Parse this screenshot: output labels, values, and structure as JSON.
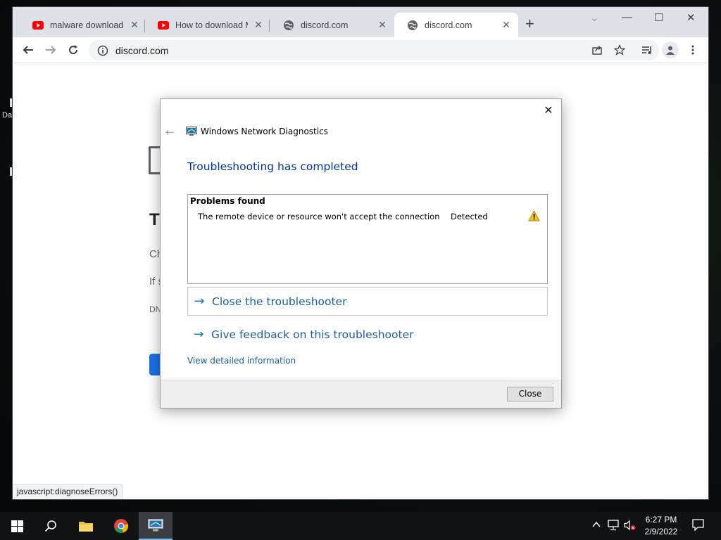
{
  "desktop": {
    "label_fragment": "Da"
  },
  "browser": {
    "tabs": [
      {
        "title": "malware download fi",
        "favicon": "youtube-icon",
        "active": false
      },
      {
        "title": "How to download MI",
        "favicon": "youtube-icon",
        "active": false
      },
      {
        "title": "discord.com",
        "favicon": "globe-icon",
        "active": false
      },
      {
        "title": "discord.com",
        "favicon": "globe-icon",
        "active": true
      }
    ],
    "close_glyph": "✕",
    "new_tab_glyph": "+",
    "window_controls": {
      "minimize": "—",
      "maximize": "☐",
      "close": "✕",
      "tab_search": "⌄"
    },
    "address": {
      "url": "discord.com"
    },
    "status_text": "javascript:diagnoseErrors()"
  },
  "error_page": {
    "heading_fragment": "T",
    "line1_fragment": "Ch",
    "line2_fragment": "If s",
    "code_fragment": "DN"
  },
  "dialog": {
    "app_title": "Windows Network Diagnostics",
    "heading": "Troubleshooting has completed",
    "problems_header": "Problems found",
    "problems": [
      {
        "description": "The remote device or resource won't accept the connection",
        "status": "Detected",
        "icon": "warning-icon"
      }
    ],
    "links": [
      {
        "label": "Close the troubleshooter",
        "icon": "arrow-right-icon"
      },
      {
        "label": "Give feedback on this troubleshooter",
        "icon": "arrow-right-icon"
      }
    ],
    "detail_link": "View detailed information",
    "close_button": "Close",
    "close_glyph": "✕",
    "back_glyph": "←"
  },
  "taskbar": {
    "time": "6:27 PM",
    "date": "2/9/2022"
  },
  "colors": {
    "dialog_heading": "#003399",
    "link": "#1a5fa0",
    "chrome_frame": "#dee1e6",
    "taskbar": "#101214",
    "accent_blue": "#1a73e8"
  }
}
